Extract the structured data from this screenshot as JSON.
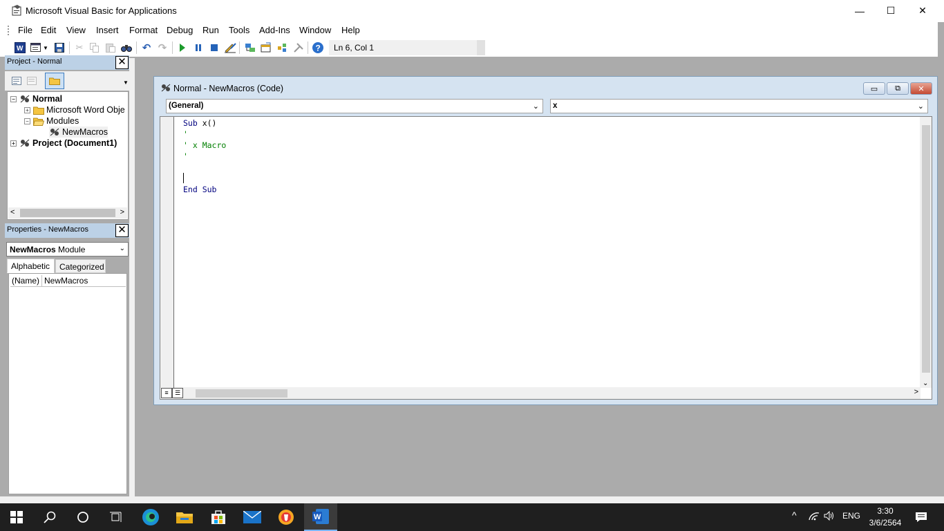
{
  "window": {
    "title": "Microsoft Visual Basic for Applications",
    "minimize": "—",
    "maximize": "☐",
    "close": "✕"
  },
  "menu": [
    "File",
    "Edit",
    "View",
    "Insert",
    "Format",
    "Debug",
    "Run",
    "Tools",
    "Add-Ins",
    "Window",
    "Help"
  ],
  "toolbar": {
    "status": "Ln 6, Col 1"
  },
  "project": {
    "title": "Project - Normal",
    "close": "✕",
    "tree": [
      {
        "label": "Normal",
        "bold": true
      },
      {
        "label": "Microsoft Word Obje"
      },
      {
        "label": "Modules"
      },
      {
        "label": "NewMacros"
      },
      {
        "label": "Project (Document1)",
        "bold": true
      }
    ]
  },
  "properties": {
    "title": "Properties - NewMacros",
    "close": "✕",
    "object_name": "NewMacros",
    "object_type": "Module",
    "tabs": [
      "Alphabetic",
      "Categorized"
    ],
    "rows": [
      {
        "name": "(Name)",
        "value": "NewMacros"
      }
    ]
  },
  "code_window": {
    "title": "Normal - NewMacros (Code)",
    "object_combo": "(General)",
    "proc_combo": "x",
    "lines": [
      {
        "kw": "Sub",
        "rest": " x()"
      },
      {
        "cm": "'"
      },
      {
        "cm": "' x Macro"
      },
      {
        "cm": "'"
      },
      {
        "text": ""
      },
      {
        "kw": "End Sub",
        "rest": ""
      }
    ]
  },
  "taskbar": {
    "language": "ENG",
    "time": "3:30",
    "date": "3/6/2564"
  }
}
